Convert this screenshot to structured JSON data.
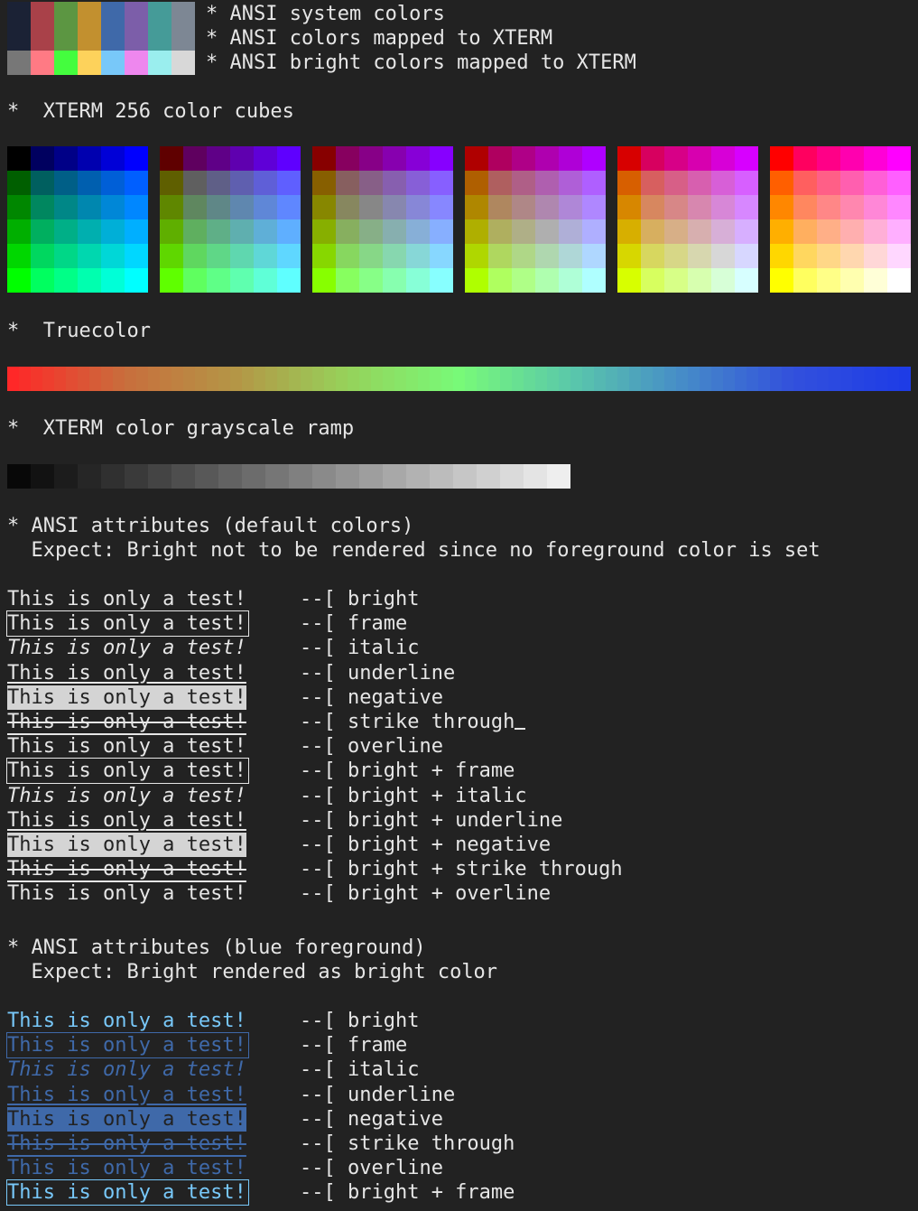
{
  "ansi": {
    "system_colors": [
      "#1b2235",
      "#a94149",
      "#5c9642",
      "#c2902f",
      "#3f69a9",
      "#7c5ea9",
      "#459b98",
      "#7d8794"
    ],
    "bright_colors": [
      "#777777",
      "#ff7a84",
      "#44fd3e",
      "#fdd25b",
      "#78c8f9",
      "#ee87ee",
      "#9aeeee",
      "#d8d8d8"
    ],
    "lines": [
      "* ANSI system colors",
      "* ANSI colors mapped to XTERM",
      "* ANSI bright colors mapped to XTERM"
    ]
  },
  "headings": {
    "cubes": "*  XTERM 256 color cubes",
    "truecolor": "*  Truecolor",
    "grayscale": "*  XTERM color grayscale ramp"
  },
  "section_default": {
    "title": "* ANSI attributes (default colors)",
    "expect": "  Expect: Bright not to be rendered since no foreground color is set"
  },
  "section_blue": {
    "title": "* ANSI attributes (blue foreground)",
    "expect": "  Expect: Bright rendered as bright color"
  },
  "sample_text": "This is only a test!",
  "default_rows": [
    {
      "label": "--[ bright"
    },
    {
      "label": "--[ frame"
    },
    {
      "label": "--[ italic"
    },
    {
      "label": "--[ underline"
    },
    {
      "label": "--[ negative"
    },
    {
      "label": "--[ strike through"
    },
    {
      "label": "--[ overline"
    },
    {
      "label": "--[ bright + frame"
    },
    {
      "label": "--[ bright + italic"
    },
    {
      "label": "--[ bright + underline"
    },
    {
      "label": "--[ bright + negative"
    },
    {
      "label": "--[ bright + strike through"
    },
    {
      "label": "--[ bright + overline"
    }
  ],
  "blue_rows": [
    {
      "label": "--[ bright"
    },
    {
      "label": "--[ frame"
    },
    {
      "label": "--[ italic"
    },
    {
      "label": "--[ underline"
    },
    {
      "label": "--[ negative"
    },
    {
      "label": "--[ strike through"
    },
    {
      "label": "--[ overline"
    },
    {
      "label": "--[ bright + frame"
    }
  ],
  "colors": {
    "fg": "#e6e6e6",
    "bg": "#222222",
    "negative_bg": "#d4d4d4",
    "blue": "#3f69a9",
    "bright_blue": "#78c8f9"
  }
}
